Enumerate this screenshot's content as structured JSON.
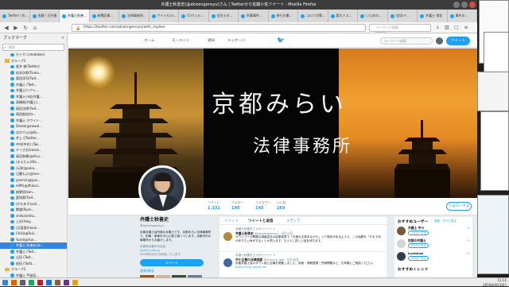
{
  "window": {
    "title": "弁護士秋善史(@akizengensyu)さん | Twitterから佐藤小佐ツイート - Mozilla Firefox"
  },
  "tabs": [
    {
      "label": "Twitter / 京..."
    },
    {
      "label": "佐藤 / 日弁連"
    },
    {
      "label": "弁護士秋善..."
    },
    {
      "label": "新聞記事..."
    },
    {
      "label": "法律事務所..."
    },
    {
      "label": "サイトル/ル..."
    },
    {
      "label": "(1)ウェル..."
    },
    {
      "label": "会計士の..."
    },
    {
      "label": "刑事事件..."
    },
    {
      "label": "修行文書..."
    },
    {
      "label": "コロナ対策..."
    },
    {
      "label": "要大人ス..."
    },
    {
      "label": "いじめの..."
    },
    {
      "label": "(会計テ..."
    },
    {
      "label": "弁護士 常佐"
    },
    {
      "label": "事件の..."
    }
  ],
  "nav": {
    "url": "https://twitter.com/akizengensyu/with_replies",
    "zoom": "80%",
    "search_placeholder": "キーワード検索"
  },
  "bookmarks": {
    "title": "ブックマーク",
    "search_placeholder": "検索",
    "items": [
      {
        "label": "モトケン(motoken)",
        "type": "item"
      },
      {
        "label": "グループ1",
        "type": "folder"
      },
      {
        "label": "坂井 俊(Twitter)",
        "type": "item"
      },
      {
        "label": "松本次郎(Tsuka...",
        "type": "item"
      },
      {
        "label": "奥田洋司(Twit...",
        "type": "item"
      },
      {
        "label": "弁護士 (Twit...",
        "type": "item"
      },
      {
        "label": "弁護士(リクレ...",
        "type": "item"
      },
      {
        "label": "弁護士小松(弁護...",
        "type": "item"
      },
      {
        "label": "高橋裕(弁護士)...",
        "type": "item"
      },
      {
        "label": "高田法律(Twit...",
        "type": "item"
      },
      {
        "label": "高田航由(ta...",
        "type": "item"
      },
      {
        "label": "弁護士 ホワイト...",
        "type": "item"
      },
      {
        "label": "Shoko(@sawal...",
        "type": "item"
      },
      {
        "label": "ばびでん(@Ka...",
        "type": "item"
      },
      {
        "label": "井上 ((Twitter...",
        "type": "item"
      },
      {
        "label": "中村(中村) (Twi...",
        "type": "item"
      },
      {
        "label": "チイさお(kasas...",
        "type": "item"
      },
      {
        "label": "高田和尋(@Aisu...",
        "type": "item"
      },
      {
        "label": "(まえたん)(Ka...",
        "type": "item"
      },
      {
        "label": "(元秋(gsuka...",
        "type": "item"
      },
      {
        "label": "日暮もよ(@han...",
        "type": "item"
      },
      {
        "label": "yasmin(@yas...",
        "type": "item"
      },
      {
        "label": "mPK(@dfukus...",
        "type": "item"
      },
      {
        "label": "新野田(ken...",
        "type": "item"
      },
      {
        "label": "愛知県(Twit...",
        "type": "item"
      },
      {
        "label": "(かもめ子(ash...",
        "type": "item"
      },
      {
        "label": "数論(Ryan...",
        "type": "item"
      },
      {
        "label": "shiho(shiho...",
        "type": "item"
      },
      {
        "label": "上杉(Yoky...",
        "type": "item"
      },
      {
        "label": "(日菜香(hinok...",
        "type": "item"
      },
      {
        "label": "Chiki(@Ruk...",
        "type": "item"
      },
      {
        "label": "Yurid(@Yun...",
        "type": "item"
      },
      {
        "label": "弁護士 秋善史(ak...",
        "type": "selected"
      },
      {
        "label": "弁護士 (Twit...",
        "type": "item"
      },
      {
        "label": "山田 (Twit...",
        "type": "item"
      },
      {
        "label": "前田 (Twitt...",
        "type": "item"
      },
      {
        "label": "グループ2",
        "type": "folder"
      },
      {
        "label": "弁護士 芦部証...",
        "type": "item"
      },
      {
        "label": "(ひと)ろ(はな...",
        "type": "item"
      },
      {
        "label": "小川 秋(Twit...",
        "type": "item"
      },
      {
        "label": "ケリン(Twit...",
        "type": "item"
      }
    ]
  },
  "twitter_nav": {
    "home": "ホーム",
    "moments": "モーメント",
    "notifications": "通知",
    "messages": "メッセージ",
    "search_placeholder": "キーワード検索",
    "tweet_button": "ツイート"
  },
  "banner": {
    "title": "京都みらい",
    "subtitle": "法律事務所"
  },
  "stats": [
    {
      "label": "ツイート",
      "value": "1,331"
    },
    {
      "label": "フォロー",
      "value": "190"
    },
    {
      "label": "フォロワー",
      "value": "145"
    },
    {
      "label": "いいね",
      "value": "269"
    }
  ],
  "follow_button": "フォローする",
  "profile": {
    "name": "弁護士秋善史",
    "handle": "@akizengensyu",
    "bio": "京都弁護士会所属の弁護士です。京都みらい法律事務所で、刑事・家事を中心に取り扱っています。京都市内の事務所からお届けします。",
    "location": "京都府京都市中京区",
    "link": "kyoto-mirai.jp",
    "joined": "2016年1月から利用しています",
    "tweet_button": "ツイート",
    "photos_label": "画像/動画"
  },
  "timeline": {
    "tabs": [
      {
        "label": "ツイート"
      },
      {
        "label": "ツイートと返信"
      },
      {
        "label": "メディア"
      }
    ],
    "tweets": [
      {
        "context": "弁護士秋善史さんがリツイート",
        "name": "弁護士秋善史",
        "handle": "@akizengensyu · 9月19日",
        "body": "オウンゴール問題の調査会社の結果発表で「付度の文書あるかも」って発言があるようで、この話題を「それで何か作りたい気がする」とか思います。もう少し詳しい話を待ちます。"
      },
      {
        "context": "弁護士秋善史さんがリツイート",
        "name": "中小企業の法律相談",
        "handle": "@chusho_law · 9月18日",
        "body": "京都弁護士会のタウン誌に記事を掲載しました。相続・債務整理・労働問題など、お気軽にご相談ください。",
        "link": "kyoto-mirai.jp/column"
      }
    ]
  },
  "who_to_follow": {
    "title": "おすすめユーザー",
    "refresh": "更新 · すべて見る",
    "users": [
      {
        "name": "弁護士 中川",
        "button": "フォローする"
      },
      {
        "name": "京都の弁護士",
        "button": "フォローする"
      },
      {
        "name": "kyotolaw",
        "button": "フォローする"
      }
    ],
    "trends_title": "おすすめトレンド"
  },
  "taskbar": {
    "time": "11:11",
    "date": "2019年9月10日"
  }
}
